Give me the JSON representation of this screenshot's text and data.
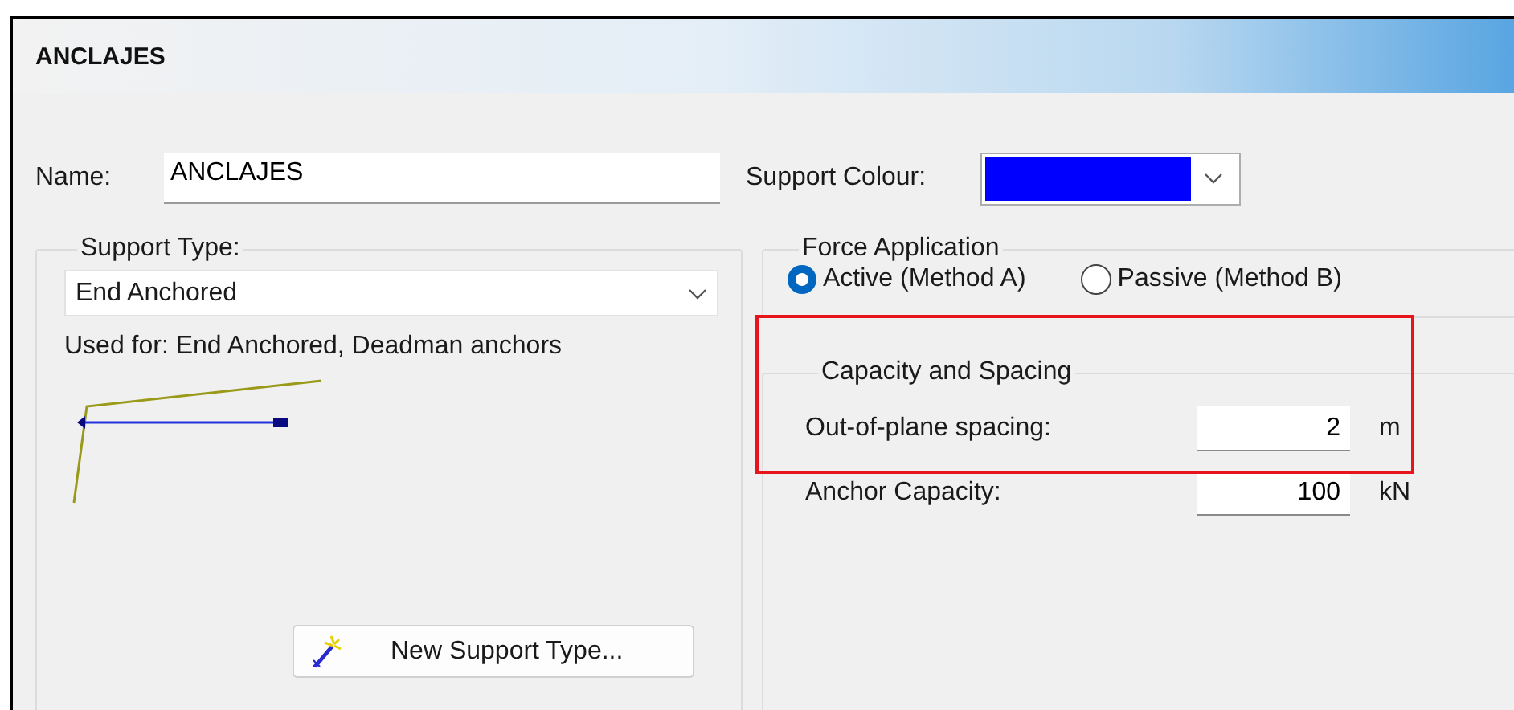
{
  "window": {
    "title": "ANCLAJES"
  },
  "name_field": {
    "label": "Name:",
    "value": "ANCLAJES"
  },
  "support_colour": {
    "label": "Support Colour:",
    "color": "#0000ff"
  },
  "support_type": {
    "legend": "Support Type:",
    "value": "End Anchored",
    "used_for": "Used for: End Anchored, Deadman anchors",
    "button": "New Support Type..."
  },
  "force_application": {
    "legend": "Force Application",
    "options": [
      {
        "label": "Active (Method A)",
        "selected": true
      },
      {
        "label": "Passive (Method B)",
        "selected": false
      }
    ]
  },
  "capacity_and_spacing": {
    "legend": "Capacity and Spacing",
    "fields": [
      {
        "label": "Out-of-plane spacing:",
        "value": "2",
        "unit": "m"
      },
      {
        "label": "Anchor Capacity:",
        "value": "100",
        "unit": "kN"
      }
    ]
  },
  "highlight": {
    "kind": "rectangle"
  }
}
